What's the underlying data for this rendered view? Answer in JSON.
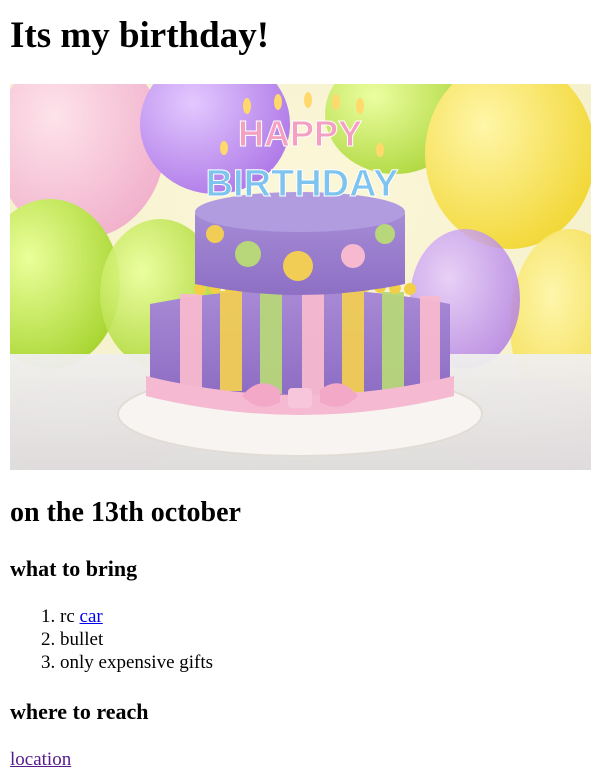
{
  "title": "Its my birthday!",
  "image": {
    "topper_line1": "HAPPY",
    "topper_line2": "BIRTHDAY"
  },
  "date_heading": "on the 13th october",
  "bring": {
    "heading": "what to bring",
    "items": [
      {
        "prefix": "rc ",
        "link": "car"
      },
      {
        "text": "bullet"
      },
      {
        "text": "only expensive gifts"
      }
    ]
  },
  "reach": {
    "heading": "where to reach",
    "link": "location"
  },
  "colors": {
    "link": "#0000ee",
    "visited_link": "#551a8b"
  }
}
